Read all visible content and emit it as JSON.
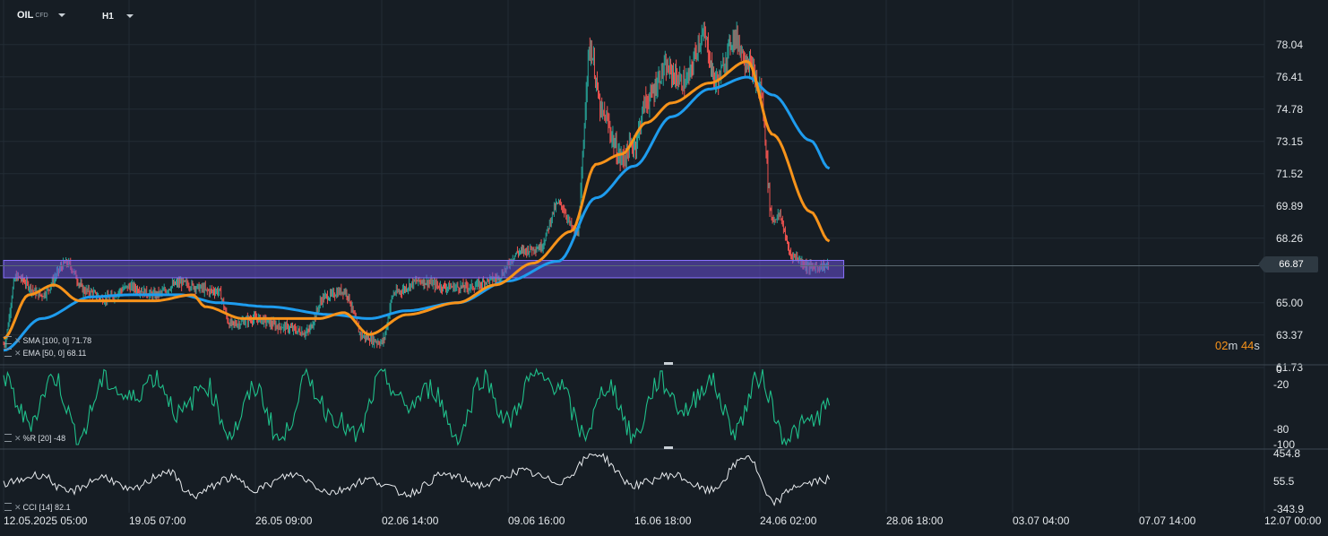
{
  "toolbar": {
    "symbol": "OIL",
    "symbol_type": "CFD",
    "timeframe": "H1"
  },
  "indicators": {
    "sma_label": "SMA [100, 0] 71.78",
    "ema_label": "EMA [50, 0] 68.11",
    "wr_label": "%R [20] -48",
    "cci_label": "CCI [14] 82.1"
  },
  "countdown": {
    "min_value": "02",
    "min_unit": "m",
    "sec_value": "44",
    "sec_unit": "s"
  },
  "current_price": "66.87",
  "colors": {
    "background": "#161d24",
    "grid": "#222c35",
    "candle_up": "#26a69a",
    "candle_down": "#ef5350",
    "sma": "#1e9cee",
    "ema": "#f7931a",
    "zone": "#6a4fd6",
    "wr": "#1fbf8a",
    "cci": "#e8ebee"
  },
  "chart_data": [
    {
      "type": "candlestick",
      "title": "OIL CFD H1",
      "y_ticks": [
        "78.04",
        "76.41",
        "74.78",
        "73.15",
        "71.52",
        "69.89",
        "68.26",
        "65.00",
        "63.37",
        "61.73"
      ],
      "ylim": [
        61.73,
        79.4
      ],
      "x_ticks": [
        "12.05.2025 05:00",
        "19.05 07:00",
        "26.05 09:00",
        "02.06 14:00",
        "09.06 16:00",
        "16.06 18:00",
        "24.06 02:00",
        "28.06 18:00",
        "03.07 04:00",
        "07.07 14:00",
        "12.07 00:00"
      ],
      "x_range": [
        0,
        1.0
      ],
      "data_end": 0.655,
      "zone": [
        66.35,
        67.05
      ],
      "current_price": 66.87,
      "anchors": [
        [
          0.0,
          62.9
        ],
        [
          0.01,
          66.3
        ],
        [
          0.03,
          65.4
        ],
        [
          0.05,
          67.0
        ],
        [
          0.065,
          65.6
        ],
        [
          0.08,
          65.2
        ],
        [
          0.1,
          65.8
        ],
        [
          0.12,
          65.4
        ],
        [
          0.14,
          66.0
        ],
        [
          0.16,
          65.7
        ],
        [
          0.17,
          65.6
        ],
        [
          0.16,
          65.6
        ],
        [
          0.18,
          63.9
        ],
        [
          0.2,
          64.2
        ],
        [
          0.22,
          63.8
        ],
        [
          0.24,
          63.5
        ],
        [
          0.255,
          65.3
        ],
        [
          0.27,
          65.6
        ],
        [
          0.285,
          63.3
        ],
        [
          0.3,
          63.0
        ],
        [
          0.31,
          65.5
        ],
        [
          0.33,
          66.1
        ],
        [
          0.35,
          65.8
        ],
        [
          0.37,
          65.8
        ],
        [
          0.39,
          66.2
        ],
        [
          0.41,
          67.6
        ],
        [
          0.425,
          67.8
        ],
        [
          0.44,
          70.0
        ],
        [
          0.455,
          68.5
        ],
        [
          0.465,
          77.8
        ],
        [
          0.475,
          74.5
        ],
        [
          0.49,
          72.3
        ],
        [
          0.5,
          73.0
        ],
        [
          0.51,
          75.2
        ],
        [
          0.525,
          76.8
        ],
        [
          0.54,
          76.1
        ],
        [
          0.555,
          78.5
        ],
        [
          0.565,
          76.2
        ],
        [
          0.58,
          78.4
        ],
        [
          0.59,
          77.2
        ],
        [
          0.6,
          75.8
        ],
        [
          0.61,
          69.2
        ],
        [
          0.615,
          69.4
        ],
        [
          0.625,
          67.4
        ],
        [
          0.64,
          66.8
        ],
        [
          0.655,
          66.87
        ]
      ],
      "series": [
        {
          "name": "SMA [100, 0]",
          "anchors": [
            [
              0.0,
              62.6
            ],
            [
              0.03,
              64.2
            ],
            [
              0.07,
              65.3
            ],
            [
              0.1,
              65.4
            ],
            [
              0.14,
              65.4
            ],
            [
              0.17,
              65.0
            ],
            [
              0.21,
              64.8
            ],
            [
              0.26,
              64.4
            ],
            [
              0.29,
              64.2
            ],
            [
              0.32,
              64.6
            ],
            [
              0.36,
              65.0
            ],
            [
              0.4,
              66.1
            ],
            [
              0.44,
              67.1
            ],
            [
              0.47,
              70.3
            ],
            [
              0.5,
              71.9
            ],
            [
              0.53,
              74.4
            ],
            [
              0.56,
              75.8
            ],
            [
              0.59,
              76.4
            ],
            [
              0.61,
              75.5
            ],
            [
              0.64,
              73.2
            ],
            [
              0.655,
              71.78
            ]
          ]
        },
        {
          "name": "EMA [50, 0]",
          "anchors": [
            [
              0.0,
              63.2
            ],
            [
              0.02,
              65.4
            ],
            [
              0.04,
              65.9
            ],
            [
              0.06,
              65.1
            ],
            [
              0.09,
              65.1
            ],
            [
              0.12,
              65.1
            ],
            [
              0.15,
              65.4
            ],
            [
              0.16,
              64.8
            ],
            [
              0.19,
              64.2
            ],
            [
              0.22,
              64.2
            ],
            [
              0.25,
              64.2
            ],
            [
              0.27,
              64.5
            ],
            [
              0.29,
              63.4
            ],
            [
              0.32,
              64.4
            ],
            [
              0.36,
              65.0
            ],
            [
              0.39,
              65.9
            ],
            [
              0.42,
              67.0
            ],
            [
              0.45,
              68.6
            ],
            [
              0.47,
              72.0
            ],
            [
              0.49,
              72.5
            ],
            [
              0.51,
              74.1
            ],
            [
              0.53,
              75.1
            ],
            [
              0.56,
              76.1
            ],
            [
              0.59,
              77.2
            ],
            [
              0.61,
              73.5
            ],
            [
              0.64,
              69.6
            ],
            [
              0.655,
              68.11
            ]
          ]
        }
      ]
    },
    {
      "type": "line",
      "title": "%R [20]",
      "y_ticks": [
        "0",
        "-20",
        "-80",
        "-100"
      ],
      "ylim": [
        -100,
        0
      ],
      "last_value": -48,
      "anchors": [
        [
          0.0,
          -15
        ],
        [
          0.02,
          -70
        ],
        [
          0.04,
          -10
        ],
        [
          0.06,
          -90
        ],
        [
          0.08,
          -15
        ],
        [
          0.1,
          -40
        ],
        [
          0.12,
          -10
        ],
        [
          0.14,
          -60
        ],
        [
          0.16,
          -20
        ],
        [
          0.18,
          -85
        ],
        [
          0.2,
          -25
        ],
        [
          0.22,
          -95
        ],
        [
          0.24,
          -15
        ],
        [
          0.26,
          -60
        ],
        [
          0.28,
          -90
        ],
        [
          0.3,
          -10
        ],
        [
          0.32,
          -50
        ],
        [
          0.34,
          -25
        ],
        [
          0.36,
          -90
        ],
        [
          0.38,
          -10
        ],
        [
          0.4,
          -70
        ],
        [
          0.42,
          -10
        ],
        [
          0.44,
          -20
        ],
        [
          0.46,
          -85
        ],
        [
          0.48,
          -20
        ],
        [
          0.5,
          -90
        ],
        [
          0.52,
          -15
        ],
        [
          0.54,
          -55
        ],
        [
          0.56,
          -15
        ],
        [
          0.58,
          -80
        ],
        [
          0.6,
          -10
        ],
        [
          0.62,
          -90
        ],
        [
          0.64,
          -70
        ],
        [
          0.655,
          -48
        ]
      ]
    },
    {
      "type": "line",
      "title": "CCI [14]",
      "y_ticks": [
        "454.8",
        "55.5",
        "-343.9"
      ],
      "ylim": [
        -343.9,
        454.8
      ],
      "last_value": 82.1,
      "anchors": [
        [
          0.0,
          20
        ],
        [
          0.03,
          150
        ],
        [
          0.05,
          -100
        ],
        [
          0.08,
          120
        ],
        [
          0.1,
          -80
        ],
        [
          0.13,
          200
        ],
        [
          0.15,
          -150
        ],
        [
          0.18,
          100
        ],
        [
          0.2,
          -50
        ],
        [
          0.23,
          150
        ],
        [
          0.26,
          -100
        ],
        [
          0.29,
          80
        ],
        [
          0.32,
          -120
        ],
        [
          0.35,
          150
        ],
        [
          0.38,
          0
        ],
        [
          0.41,
          200
        ],
        [
          0.44,
          50
        ],
        [
          0.47,
          454
        ],
        [
          0.5,
          0
        ],
        [
          0.53,
          150
        ],
        [
          0.56,
          -80
        ],
        [
          0.59,
          420
        ],
        [
          0.61,
          -250
        ],
        [
          0.63,
          0
        ],
        [
          0.655,
          82.1
        ]
      ]
    }
  ]
}
